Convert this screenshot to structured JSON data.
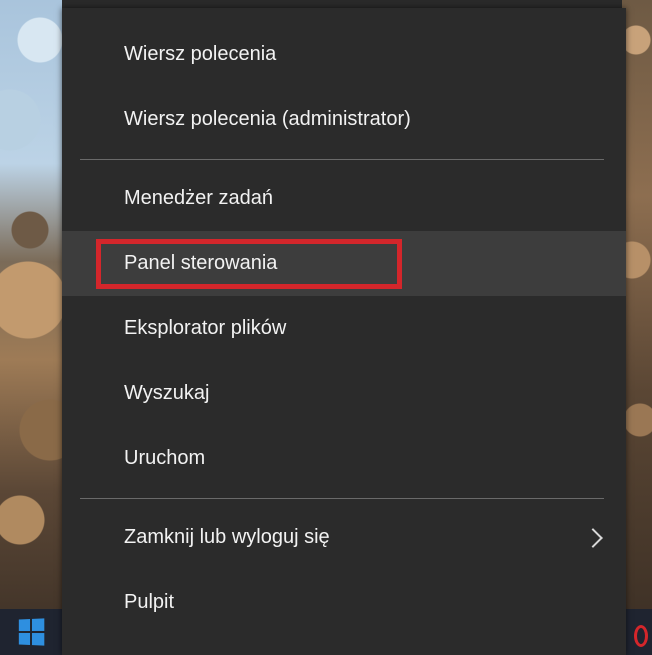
{
  "menu": {
    "items": [
      {
        "label": "Wiersz polecenia"
      },
      {
        "label": "Wiersz polecenia (administrator)"
      },
      {
        "label": "Menedżer zadań"
      },
      {
        "label": "Panel sterowania"
      },
      {
        "label": "Eksplorator plików"
      },
      {
        "label": "Wyszukaj"
      },
      {
        "label": "Uruchom"
      },
      {
        "label": "Zamknij lub wyloguj się"
      },
      {
        "label": "Pulpit"
      }
    ],
    "highlighted_index": 3,
    "submenu_index": 7
  },
  "icons": {
    "start": "windows-logo-icon",
    "submenu": "chevron-right-icon",
    "tray": "red-circle-icon"
  },
  "colors": {
    "menu_background": "#2b2b2b",
    "menu_text": "#f2f2f2",
    "highlight_background": "#3d3d3d",
    "annotation_red": "#d4262b",
    "windows_blue": "#2e8fe0"
  }
}
